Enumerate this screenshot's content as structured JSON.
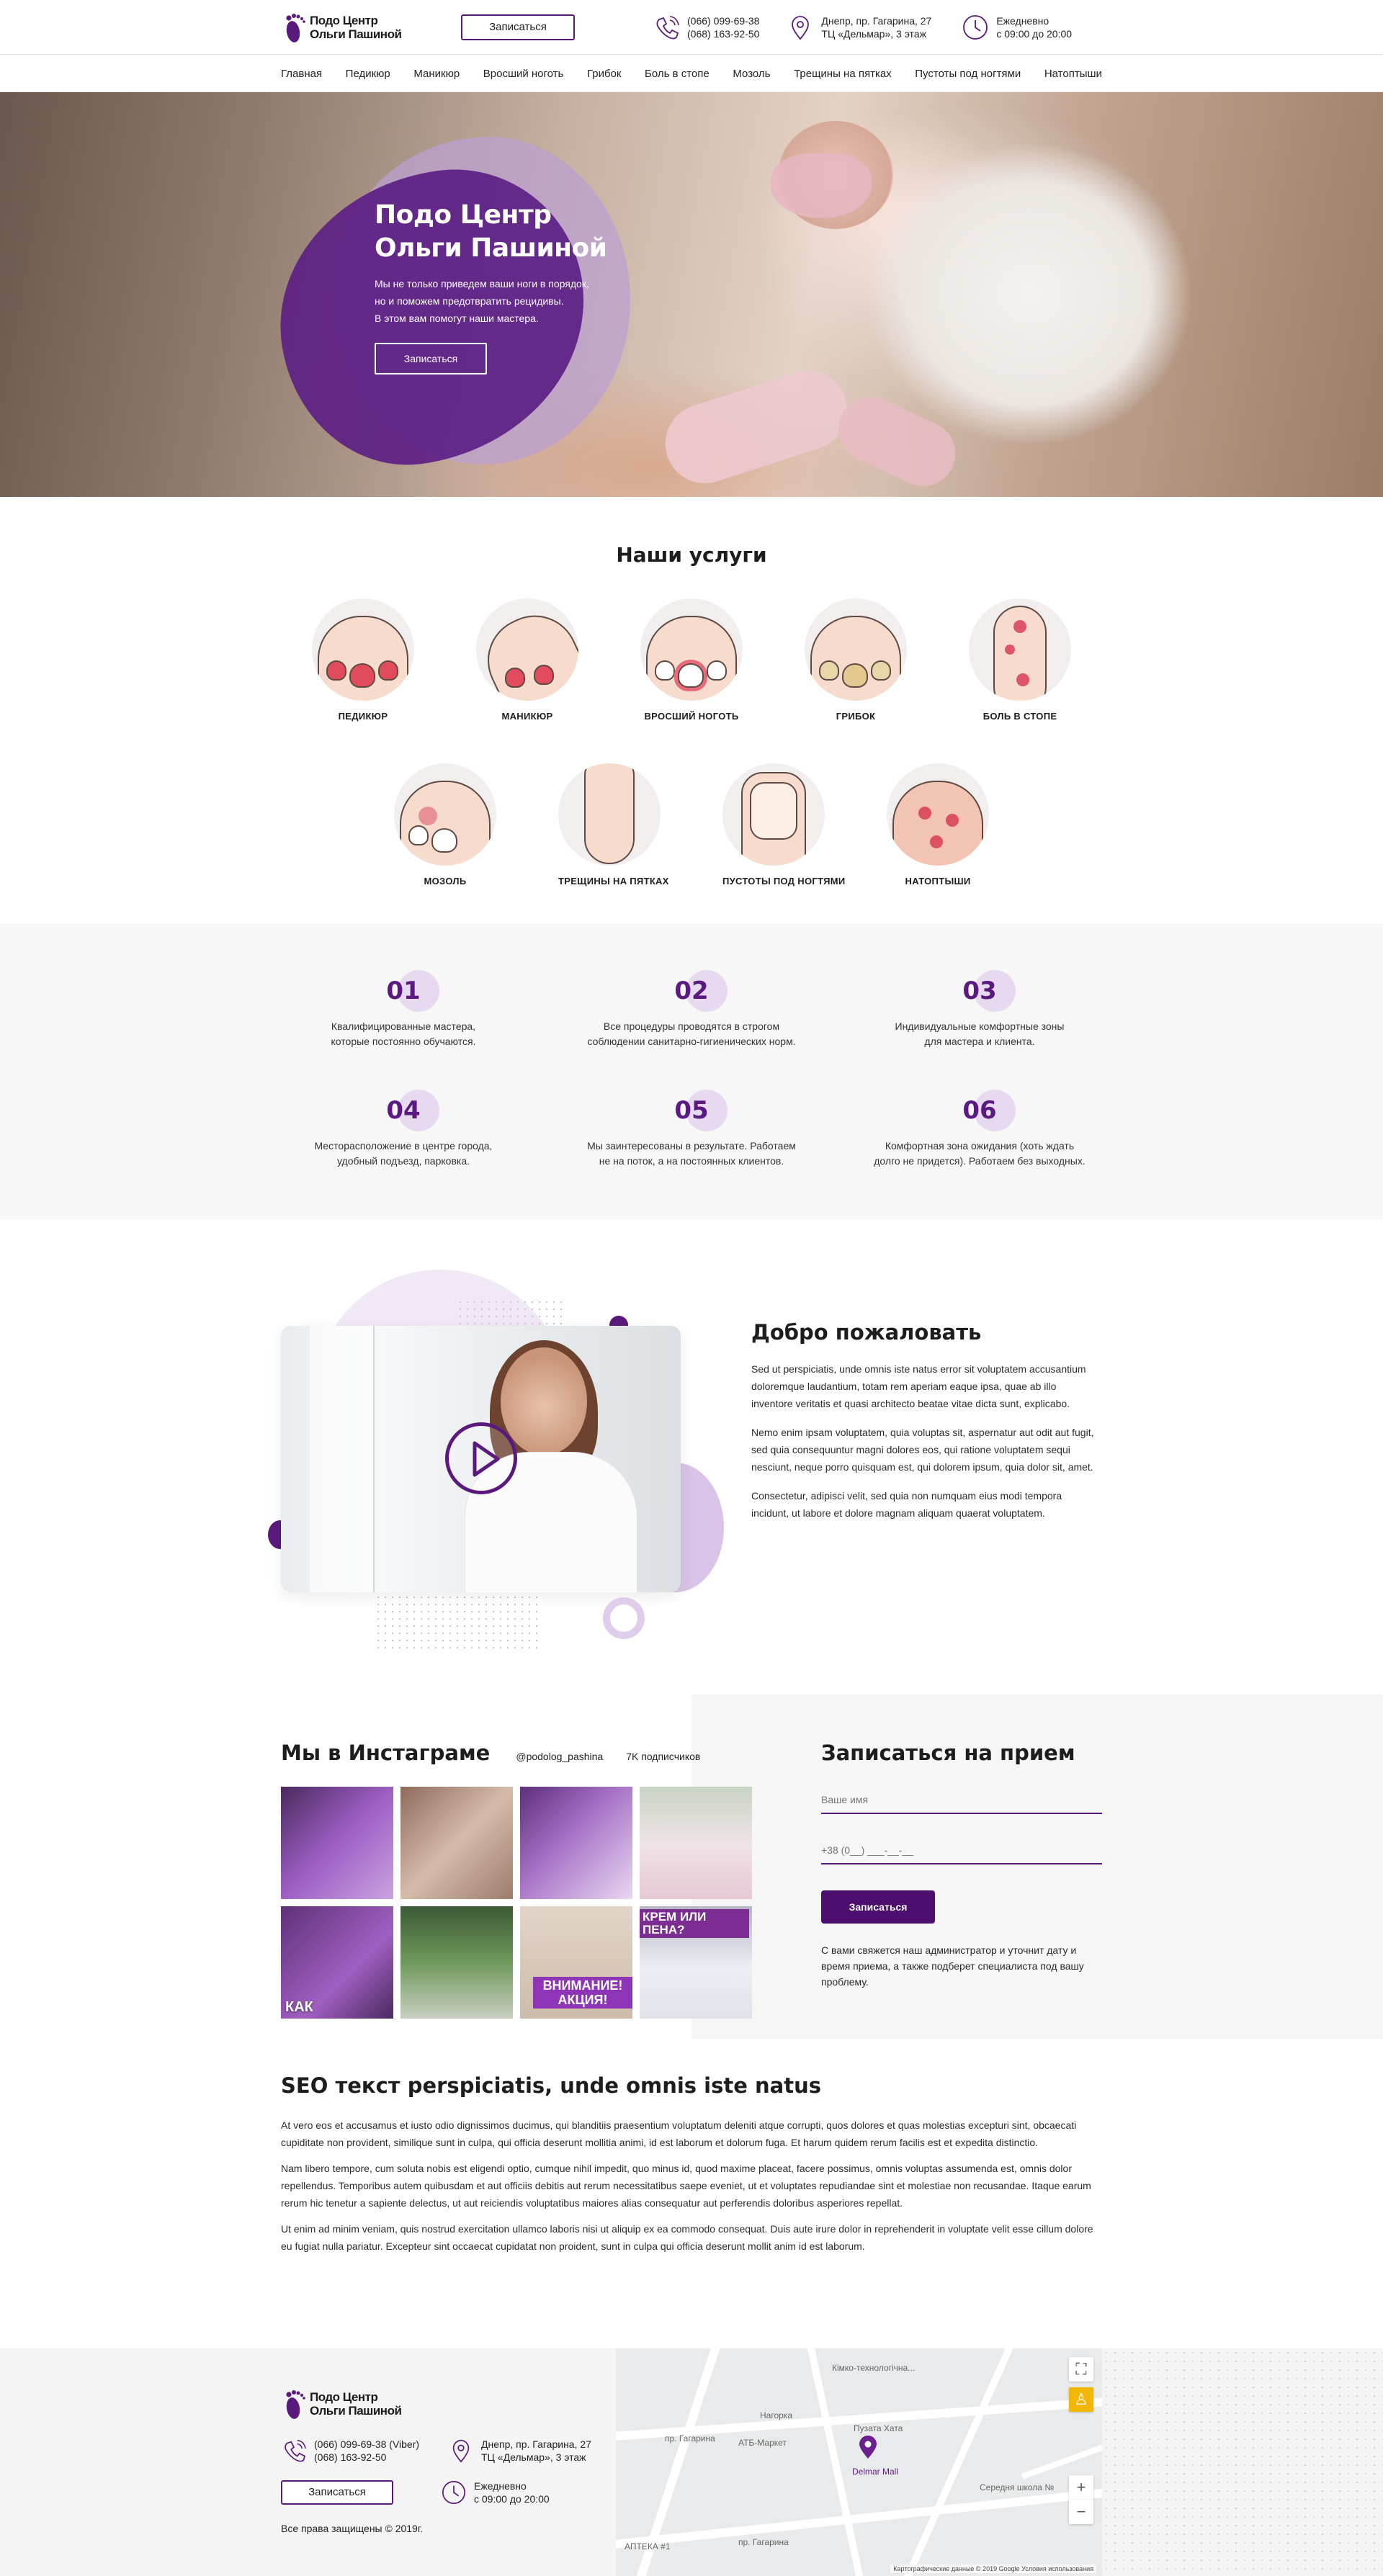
{
  "brand": {
    "line1": "Подо Центр",
    "line2": "Ольги Пашиной"
  },
  "header": {
    "book_button": "Записаться",
    "phone1": "(066) 099-69-38",
    "phone2": "(068) 163-92-50",
    "address1": "Днепр, пр. Гагарина, 27",
    "address2": "ТЦ «Дельмар», 3 этаж",
    "hours1": "Ежедневно",
    "hours2": "с 09:00 до 20:00"
  },
  "nav": [
    "Главная",
    "Педикюр",
    "Маникюр",
    "Вросший ноготь",
    "Грибок",
    "Боль в стопе",
    "Мозоль",
    "Трещины на пятках",
    "Пустоты под ногтями",
    "Натоптыши"
  ],
  "hero": {
    "title1": "Подо Центр",
    "title2": "Ольги Пашиной",
    "text1": "Мы не только приведем ваши ноги в порядок,",
    "text2": "но и поможем предотвратить рецидивы.",
    "text3": "В этом вам помогут наши мастера.",
    "button": "Записаться"
  },
  "services": {
    "title": "Наши услуги",
    "row1": [
      "ПЕДИКЮР",
      "МАНИКЮР",
      "ВРОСШИЙ НОГОТЬ",
      "ГРИБОК",
      "БОЛЬ В СТОПЕ"
    ],
    "row2": [
      "МОЗОЛЬ",
      "ТРЕЩИНЫ НА ПЯТКАХ",
      "ПУСТОТЫ ПОД НОГТЯМИ",
      "НАТОПТЫШИ"
    ]
  },
  "advantages": [
    {
      "num": "01",
      "l1": "Квалифицированные мастера,",
      "l2": "которые постоянно обучаются."
    },
    {
      "num": "02",
      "l1": "Все процедуры проводятся в строгом",
      "l2": "соблюдении санитарно-гигиенических норм."
    },
    {
      "num": "03",
      "l1": "Индивидуальные комфортные зоны",
      "l2": "для мастера и клиента."
    },
    {
      "num": "04",
      "l1": "Месторасположение в центре города,",
      "l2": "удобный подъезд, парковка."
    },
    {
      "num": "05",
      "l1": "Мы заинтересованы в результате. Работаем",
      "l2": "не на поток, а на постоянных клиентов."
    },
    {
      "num": "06",
      "l1": "Комфортная зона ожидания (хоть ждать",
      "l2": "долго не придется). Работаем без выходных."
    }
  ],
  "welcome": {
    "title": "Добро пожаловать",
    "p1": "Sed ut perspiciatis, unde omnis iste natus error sit voluptatem accusantium doloremque laudantium, totam rem aperiam eaque ipsa, quae ab illo inventore veritatis et quasi architecto beatae vitae dicta sunt, explicabo.",
    "p2": "Nemo enim ipsam voluptatem, quia voluptas sit, aspernatur aut odit aut fugit, sed quia consequuntur magni dolores eos, qui ratione voluptatem sequi nesciunt, neque porro quisquam est, qui dolorem ipsum, quia dolor sit, amet.",
    "p3": "Consectetur, adipisci velit, sed quia non numquam eius modi tempora incidunt, ut labore et dolore magnam aliquam quaerat voluptatem."
  },
  "instagram": {
    "title": "Мы в Инстаграме",
    "account": "@podolog_pashina",
    "subscribers": "7K подписчиков",
    "tiles": [
      {
        "bg": "#7e4a9e",
        "text": ""
      },
      {
        "bg": "#b79a88",
        "text": ""
      },
      {
        "bg": "#8a5aa8",
        "text": ""
      },
      {
        "bg": "#cdbfc4",
        "text": ""
      },
      {
        "bg": "#8d5aa6",
        "text": "КАК"
      },
      {
        "bg": "#4f6a46",
        "text": ""
      },
      {
        "bg": "#d3c3b7",
        "text": "ВНИМАНИЕ! АКЦИЯ!"
      },
      {
        "bg": "#d9d9e0",
        "text": "КРЕМ ИЛИ ПЕНА?"
      }
    ]
  },
  "form": {
    "title": "Записаться на прием",
    "name_placeholder": "Ваше имя",
    "phone_placeholder": "+38 (0__) ___-__-__",
    "button": "Записаться",
    "note": "С вами свяжется наш администратор и уточнит дату и время приема, а также подберет специалиста под вашу проблему."
  },
  "seo": {
    "title": "SEO текст perspiciatis, unde omnis iste natus",
    "p1": "At vero eos et accusamus et iusto odio dignissimos ducimus, qui blanditiis praesentium voluptatum deleniti atque corrupti, quos dolores et quas molestias excepturi sint, obcaecati cupiditate non provident, similique sunt in culpa, qui officia deserunt mollitia animi, id est laborum et dolorum fuga. Et harum quidem rerum facilis est et expedita distinctio.",
    "p2": "Nam libero tempore, cum soluta nobis est eligendi optio, cumque nihil impedit, quo minus id, quod maxime placeat, facere possimus, omnis voluptas assumenda est, omnis dolor repellendus. Temporibus autem quibusdam et aut officiis debitis aut rerum necessitatibus saepe eveniet, ut et voluptates repudiandae sint et molestiae non recusandae. Itaque earum rerum hic tenetur a sapiente delectus, ut aut reiciendis voluptatibus maiores alias consequatur aut perferendis doloribus asperiores repellat.",
    "p3": "Ut enim ad minim veniam, quis nostrud exercitation ullamco laboris nisi ut aliquip ex ea commodo consequat. Duis aute irure dolor in reprehenderit in voluptate velit esse cillum dolore eu fugiat nulla pariatur. Excepteur sint occaecat cupidatat non proident, sunt in culpa qui officia deserunt mollit anim id est laborum."
  },
  "footer": {
    "phone1": "(066) 099-69-38 (Viber)",
    "phone2": "(068) 163-92-50",
    "address1": "Днепр, пр. Гагарина, 27",
    "address2": "ТЦ «Дельмар», 3 этаж",
    "book_button": "Записаться",
    "hours1": "Ежедневно",
    "hours2": "с 09:00 до 20:00",
    "copyright": "Все права защищены © 2019г."
  },
  "map": {
    "labels": [
      "пр. Гагарина",
      "АТБ-Маркет",
      "Нагорка",
      "Пузата Хата",
      "Delmar Mall",
      "Середня школа №",
      "пр. Гагарина",
      "АПТЕКА #1",
      "Кімко-технологічна..."
    ],
    "attribution": "Картографические данные © 2019 Google   Условия использования"
  },
  "colors": {
    "accent": "#5a1a7c",
    "accent_light": "#e6d9f0",
    "gray_bg": "#f7f7f7"
  }
}
